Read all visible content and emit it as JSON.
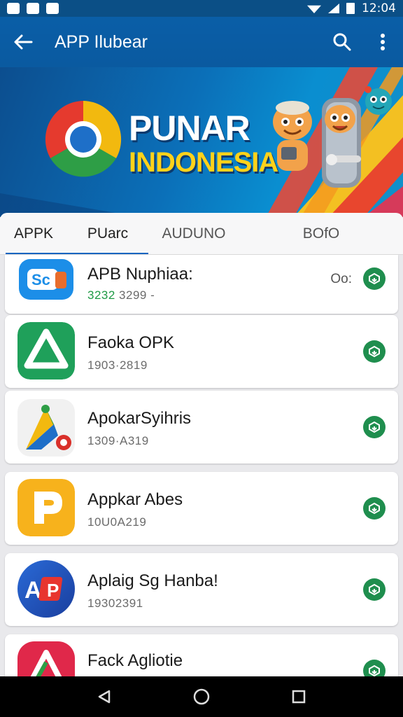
{
  "status_bar": {
    "time": "12:04"
  },
  "app_bar": {
    "title": "APP Ilubear",
    "back_icon": "arrow-back-icon",
    "search_icon": "search-icon",
    "more_icon": "more-vert-icon"
  },
  "banner": {
    "line1": "PUNAR",
    "line2": "INDONESIA"
  },
  "tabs": [
    {
      "label": "APPK",
      "active": true
    },
    {
      "label": "PUarc",
      "active": false
    },
    {
      "label": "AUDUNO",
      "active": false
    },
    {
      "label": "BOfO",
      "active": false
    }
  ],
  "apps": [
    {
      "name": "APB Nuphiaa:",
      "meta_accent": "3232",
      "meta": " 3299 -",
      "extra": "Oo:"
    },
    {
      "name": "Faoka OPK",
      "meta": "1903·2819"
    },
    {
      "name": "ApokarSyihris",
      "meta": "1309·A319"
    },
    {
      "name": "Appkar Abes",
      "meta": "10U0A219"
    },
    {
      "name": "Aplaig Sg Hanba!",
      "meta": "19302391"
    },
    {
      "name": "Fack Agliotie",
      "meta": ""
    }
  ],
  "colors": {
    "primary": "#0a5ea7",
    "tab_indicator": "#1565c0",
    "download": "#1f8e4e",
    "accent_yellow": "#ffd21a"
  }
}
